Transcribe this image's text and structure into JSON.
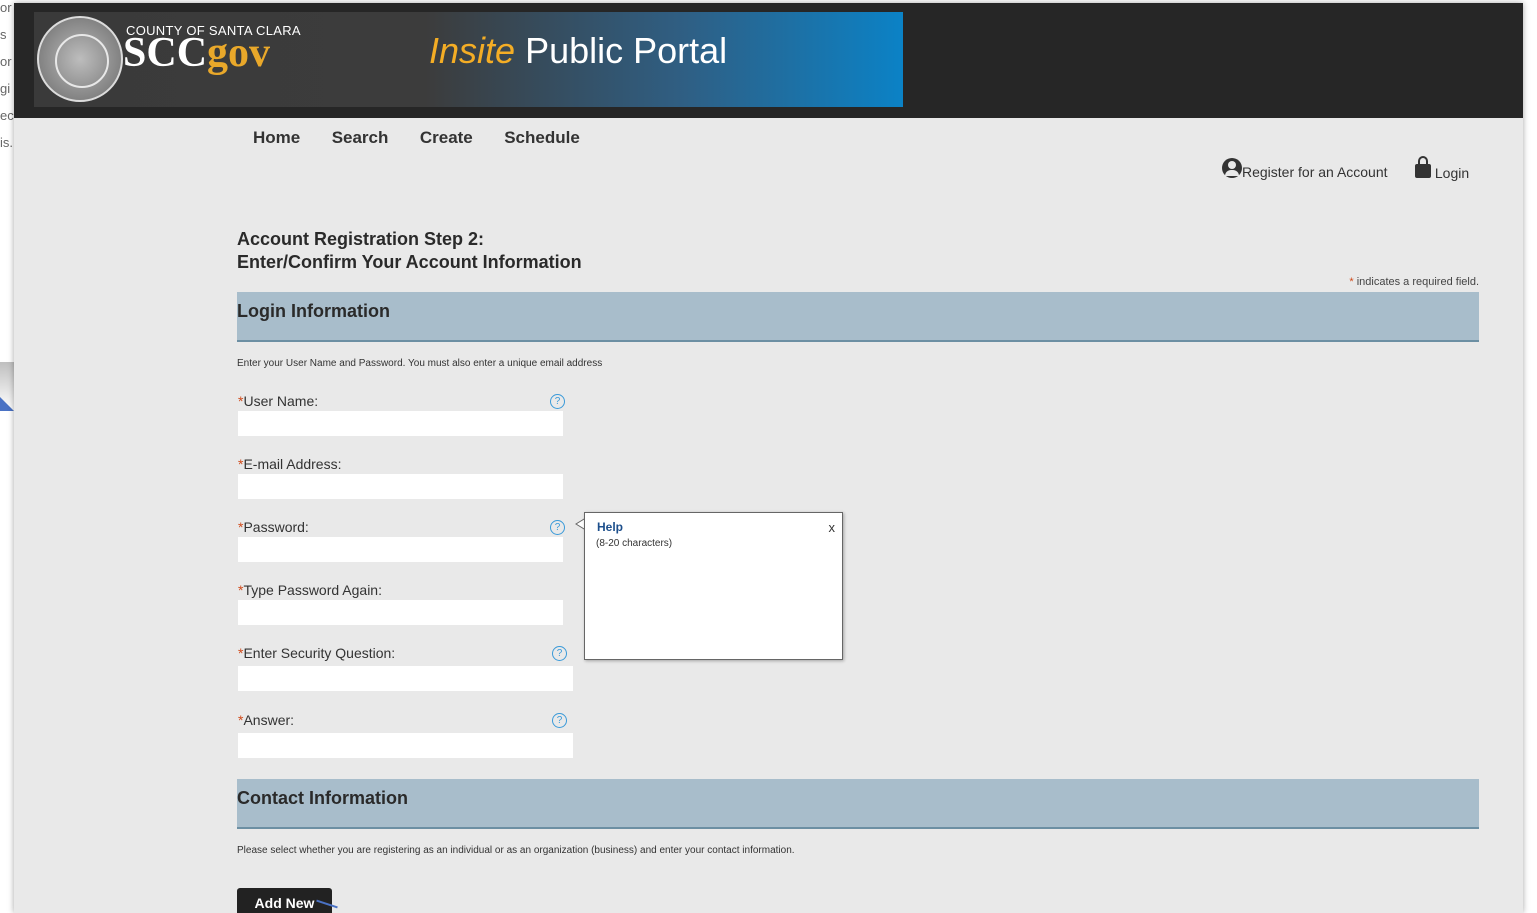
{
  "background_fragments": [
    "or",
    "s",
    "or",
    "gi",
    "ec",
    "is."
  ],
  "header": {
    "county": "COUNTY OF SANTA CLARA",
    "logo_prefix": "SCC",
    "logo_suffix": "gov",
    "portal_prefix": "Insite",
    "portal_suffix": "Public Portal"
  },
  "nav": [
    "Home",
    "Search",
    "Create",
    "Schedule"
  ],
  "account": {
    "register": "Register for an Account",
    "login": "Login"
  },
  "page": {
    "title_line1": "Account Registration Step 2:",
    "title_line2": "Enter/Confirm Your Account Information",
    "required_star": "*",
    "required_note": "indicates a required field."
  },
  "login_section": {
    "title": "Login Information",
    "intro": "Enter your User Name and Password.  You must also enter a unique email address",
    "fields": [
      {
        "label": "User Name:",
        "value": ""
      },
      {
        "label": "E-mail Address:",
        "value": ""
      },
      {
        "label": "Password:",
        "value": ""
      },
      {
        "label": "Type Password Again:",
        "value": ""
      },
      {
        "label": "Enter Security Question:",
        "value": ""
      },
      {
        "label": "Answer:",
        "value": ""
      }
    ]
  },
  "help_popup": {
    "title": "Help",
    "body": "(8-20 characters)",
    "close": "x"
  },
  "contact_section": {
    "title": "Contact Information",
    "intro": "Please select whether you are registering as an individual or as an organization (business) and enter your contact information.",
    "button": "Add New"
  },
  "colors": {
    "topbar": "#262626",
    "section_header": "#a8bdcb",
    "required_star": "#d04a1a",
    "help_icon": "#3a9ad9",
    "accent_gold": "#f4ad25"
  }
}
